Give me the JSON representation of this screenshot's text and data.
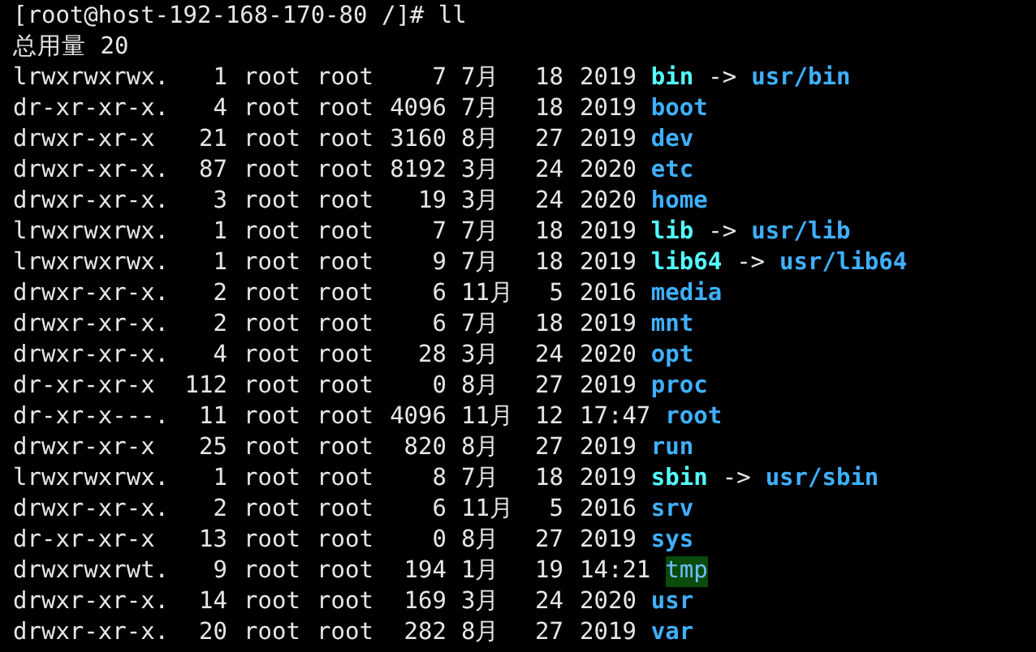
{
  "prompt": "[root@host-192-168-170-80 /]# ll",
  "total": "总用量 20",
  "rows": [
    {
      "perms": "lrwxrwxrwx.",
      "links": "1",
      "owner": "root",
      "group": "root",
      "size": "7",
      "month": "7月",
      "day": "18",
      "time": "2019",
      "name": "bin",
      "kind": "link",
      "arrow": "->",
      "target": "usr/bin"
    },
    {
      "perms": "dr-xr-xr-x.",
      "links": "4",
      "owner": "root",
      "group": "root",
      "size": "4096",
      "month": "7月",
      "day": "18",
      "time": "2019",
      "name": "boot",
      "kind": "dir"
    },
    {
      "perms": "drwxr-xr-x",
      "links": "21",
      "owner": "root",
      "group": "root",
      "size": "3160",
      "month": "8月",
      "day": "27",
      "time": "2019",
      "name": "dev",
      "kind": "dir"
    },
    {
      "perms": "drwxr-xr-x.",
      "links": "87",
      "owner": "root",
      "group": "root",
      "size": "8192",
      "month": "3月",
      "day": "24",
      "time": "2020",
      "name": "etc",
      "kind": "dir"
    },
    {
      "perms": "drwxr-xr-x.",
      "links": "3",
      "owner": "root",
      "group": "root",
      "size": "19",
      "month": "3月",
      "day": "24",
      "time": "2020",
      "name": "home",
      "kind": "dir"
    },
    {
      "perms": "lrwxrwxrwx.",
      "links": "1",
      "owner": "root",
      "group": "root",
      "size": "7",
      "month": "7月",
      "day": "18",
      "time": "2019",
      "name": "lib",
      "kind": "link",
      "arrow": "->",
      "target": "usr/lib"
    },
    {
      "perms": "lrwxrwxrwx.",
      "links": "1",
      "owner": "root",
      "group": "root",
      "size": "9",
      "month": "7月",
      "day": "18",
      "time": "2019",
      "name": "lib64",
      "kind": "link",
      "arrow": "->",
      "target": "usr/lib64"
    },
    {
      "perms": "drwxr-xr-x.",
      "links": "2",
      "owner": "root",
      "group": "root",
      "size": "6",
      "month": "11月",
      "day": "5",
      "time": "2016",
      "name": "media",
      "kind": "dir"
    },
    {
      "perms": "drwxr-xr-x.",
      "links": "2",
      "owner": "root",
      "group": "root",
      "size": "6",
      "month": "7月",
      "day": "18",
      "time": "2019",
      "name": "mnt",
      "kind": "dir"
    },
    {
      "perms": "drwxr-xr-x.",
      "links": "4",
      "owner": "root",
      "group": "root",
      "size": "28",
      "month": "3月",
      "day": "24",
      "time": "2020",
      "name": "opt",
      "kind": "dir"
    },
    {
      "perms": "dr-xr-xr-x",
      "links": "112",
      "owner": "root",
      "group": "root",
      "size": "0",
      "month": "8月",
      "day": "27",
      "time": "2019",
      "name": "proc",
      "kind": "dir"
    },
    {
      "perms": "dr-xr-x---.",
      "links": "11",
      "owner": "root",
      "group": "root",
      "size": "4096",
      "month": "11月",
      "day": "12",
      "time": "17:47",
      "name": "root",
      "kind": "dir"
    },
    {
      "perms": "drwxr-xr-x",
      "links": "25",
      "owner": "root",
      "group": "root",
      "size": "820",
      "month": "8月",
      "day": "27",
      "time": "2019",
      "name": "run",
      "kind": "dir"
    },
    {
      "perms": "lrwxrwxrwx.",
      "links": "1",
      "owner": "root",
      "group": "root",
      "size": "8",
      "month": "7月",
      "day": "18",
      "time": "2019",
      "name": "sbin",
      "kind": "link",
      "arrow": "->",
      "target": "usr/sbin"
    },
    {
      "perms": "drwxr-xr-x.",
      "links": "2",
      "owner": "root",
      "group": "root",
      "size": "6",
      "month": "11月",
      "day": "5",
      "time": "2016",
      "name": "srv",
      "kind": "dir"
    },
    {
      "perms": "dr-xr-xr-x",
      "links": "13",
      "owner": "root",
      "group": "root",
      "size": "0",
      "month": "8月",
      "day": "27",
      "time": "2019",
      "name": "sys",
      "kind": "dir"
    },
    {
      "perms": "drwxrwxrwt.",
      "links": "9",
      "owner": "root",
      "group": "root",
      "size": "194",
      "month": "1月",
      "day": "19",
      "time": "14:21",
      "name": "tmp",
      "kind": "sticky"
    },
    {
      "perms": "drwxr-xr-x.",
      "links": "14",
      "owner": "root",
      "group": "root",
      "size": "169",
      "month": "3月",
      "day": "24",
      "time": "2020",
      "name": "usr",
      "kind": "dir"
    },
    {
      "perms": "drwxr-xr-x.",
      "links": "20",
      "owner": "root",
      "group": "root",
      "size": "282",
      "month": "8月",
      "day": "27",
      "time": "2019",
      "name": "var",
      "kind": "dir"
    }
  ]
}
